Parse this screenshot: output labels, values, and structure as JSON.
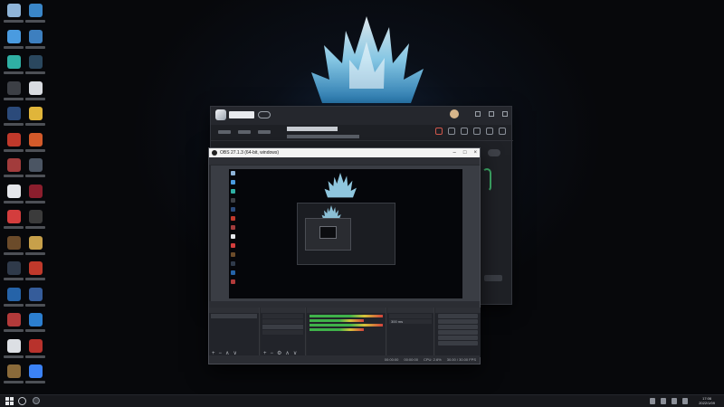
{
  "desktop": {
    "icons": [
      {
        "icon": "recycle-bin-icon",
        "color": "#8fb4d8"
      },
      {
        "icon": "network-icon",
        "color": "#3a86c8"
      },
      {
        "icon": "computer-icon",
        "color": "#4a9be0"
      },
      {
        "icon": "control-panel-icon",
        "color": "#3d7fbf"
      },
      {
        "icon": "edge-browser-icon",
        "color": "#2fb0a4"
      },
      {
        "icon": "steam-icon",
        "color": "#2a475e"
      },
      {
        "icon": "obs-icon",
        "color": "#3c3f45"
      },
      {
        "icon": "search-app-icon",
        "color": "#d9dce1"
      },
      {
        "icon": "game-icon",
        "color": "#2b4a7a"
      },
      {
        "icon": "folder-icon",
        "color": "#e0b53a"
      },
      {
        "icon": "app-icon",
        "color": "#c0392b"
      },
      {
        "icon": "app-icon",
        "color": "#d35a2a"
      },
      {
        "icon": "app-icon",
        "color": "#a23c3c"
      },
      {
        "icon": "settings-icon",
        "color": "#4b5563"
      },
      {
        "icon": "document-icon",
        "color": "#e5e7eb"
      },
      {
        "icon": "game-icon",
        "color": "#8b1e2d"
      },
      {
        "icon": "launcher-icon",
        "color": "#d33d3d"
      },
      {
        "icon": "game-icon",
        "color": "#3b3b3b"
      },
      {
        "icon": "game-icon",
        "color": "#6b4b2a"
      },
      {
        "icon": "app-icon",
        "color": "#c7a04a"
      },
      {
        "icon": "game-icon",
        "color": "#2f3a4a"
      },
      {
        "icon": "app-icon",
        "color": "#c0392b"
      },
      {
        "icon": "game-icon",
        "color": "#2563a8"
      },
      {
        "icon": "app-icon",
        "color": "#355c9a"
      },
      {
        "icon": "game-icon",
        "color": "#b23a3a"
      },
      {
        "icon": "app-icon",
        "color": "#2c7fd0"
      },
      {
        "icon": "document-icon",
        "color": "#dcdfe4"
      },
      {
        "icon": "game-icon",
        "color": "#b8322c"
      },
      {
        "icon": "game-icon",
        "color": "#8a6a3a"
      },
      {
        "icon": "app-icon",
        "color": "#3b82f6"
      }
    ]
  },
  "launcher": {
    "brand_color": "#e8eaee",
    "live_indicator_color": "#3fae6a",
    "alert_color": "#d2584d"
  },
  "obs": {
    "title_text": "OBS 27.1.3 (64-bit, windows)",
    "window_controls": [
      "–",
      "□",
      "×"
    ],
    "menu": [
      "",
      "",
      "",
      "",
      "",
      "",
      ""
    ],
    "docks": {
      "scenes": {
        "header": "",
        "items": [
          ""
        ]
      },
      "sources": {
        "header": "",
        "items": [
          "",
          "",
          "",
          ""
        ]
      },
      "mixer": {
        "header": "",
        "channels": [
          "",
          ""
        ]
      },
      "transitions": {
        "header": "",
        "duration": "300 ms"
      },
      "controls": {
        "header": "",
        "buttons": [
          "",
          "",
          "",
          "",
          "",
          ""
        ]
      }
    },
    "status": {
      "fps": "30.00 / 30.00 FPS",
      "cpu": "CPU: 2.6%",
      "time1": "00:00:00",
      "time2": "00:00:00"
    },
    "accent_green": "#3fb24a",
    "accent_red": "#d2423b"
  },
  "taskbar": {
    "clock_time": "17:06",
    "clock_date": "2022/1/09"
  }
}
